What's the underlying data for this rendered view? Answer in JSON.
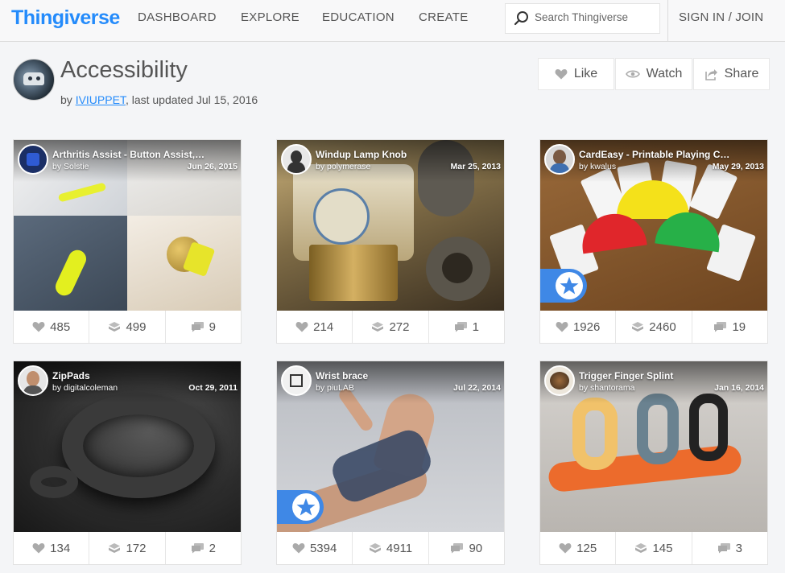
{
  "nav": {
    "logo": "Thingiverse",
    "links": [
      "DASHBOARD",
      "EXPLORE",
      "EDUCATION",
      "CREATE"
    ],
    "search_placeholder": "Search Thingiverse",
    "signin": "SIGN IN / JOIN"
  },
  "collection": {
    "title": "Accessibility",
    "by_prefix": "by ",
    "author": "IVIUPPET",
    "updated": ", last updated Jul 15, 2016",
    "actions": {
      "like": "Like",
      "watch": "Watch",
      "share": "Share"
    }
  },
  "things": [
    {
      "title": "Arthritis Assist - Button Assist, Zipper Pull, Doorknob Turner",
      "by": "by Solstie",
      "date": "Jun 26, 2015",
      "likes": "485",
      "collects": "499",
      "comments": "9",
      "featured": false
    },
    {
      "title": "Windup Lamp Knob",
      "by": "by polymerase",
      "date": "Mar 25, 2013",
      "likes": "214",
      "collects": "272",
      "comments": "1",
      "featured": false
    },
    {
      "title": "CardEasy - Printable Playing Card Holder",
      "by": "by kwalus",
      "date": "May 29, 2013",
      "likes": "1926",
      "collects": "2460",
      "comments": "19",
      "featured": true
    },
    {
      "title": "ZipPads",
      "by": "by digitalcoleman",
      "date": "Oct 29, 2011",
      "likes": "134",
      "collects": "172",
      "comments": "2",
      "featured": false
    },
    {
      "title": "Wrist brace",
      "by": "by piuLAB",
      "date": "Jul 22, 2014",
      "likes": "5394",
      "collects": "4911",
      "comments": "90",
      "featured": true
    },
    {
      "title": "Trigger Finger Splint",
      "by": "by shantorama",
      "date": "Jan 16, 2014",
      "likes": "125",
      "collects": "145",
      "comments": "3",
      "featured": false
    }
  ],
  "colors": {
    "brand": "#248bfb",
    "featured": "#3f88e6"
  }
}
